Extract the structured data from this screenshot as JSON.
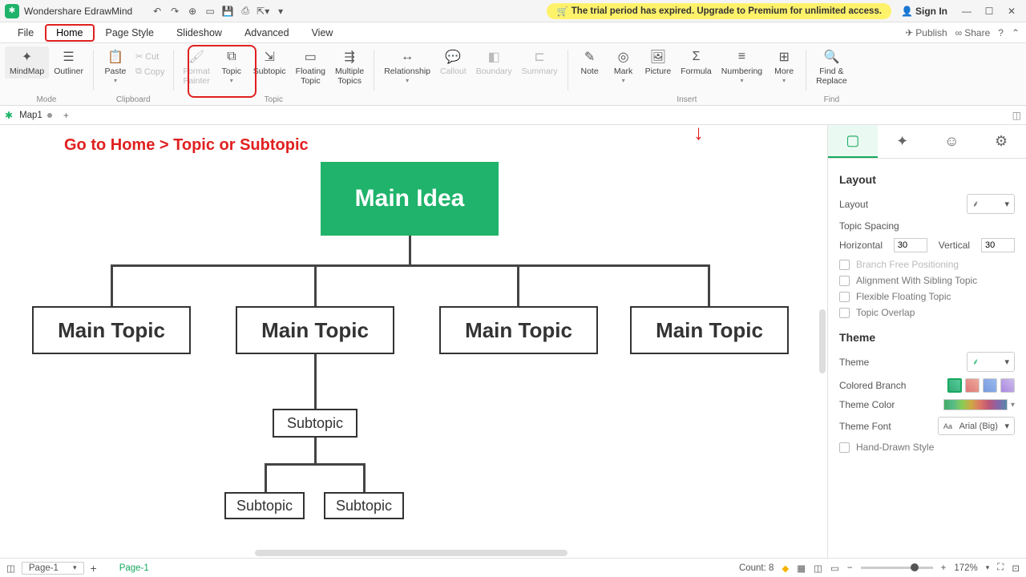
{
  "app": {
    "title": "Wondershare EdrawMind"
  },
  "titlebar": {
    "trial": "The trial period has expired. Upgrade to Premium for unlimited access.",
    "signin": "Sign In"
  },
  "menu": {
    "file": "File",
    "home": "Home",
    "pagestyle": "Page Style",
    "slideshow": "Slideshow",
    "advanced": "Advanced",
    "view": "View",
    "publish": "Publish",
    "share": "Share"
  },
  "ribbon": {
    "mindmap": "MindMap",
    "outliner": "Outliner",
    "mode": "Mode",
    "paste": "Paste",
    "cut": "Cut",
    "copy": "Copy",
    "clipboard": "Clipboard",
    "formatpainter": "Format\nPainter",
    "topic": "Topic",
    "subtopic": "Subtopic",
    "topicGroup": "Topic",
    "floating": "Floating\nTopic",
    "multiple": "Multiple\nTopics",
    "relationship": "Relationship",
    "callout": "Callout",
    "boundary": "Boundary",
    "summary": "Summary",
    "note": "Note",
    "mark": "Mark",
    "picture": "Picture",
    "formula": "Formula",
    "numbering": "Numbering",
    "more": "More",
    "insert": "Insert",
    "findreplace": "Find &\nReplace",
    "find": "Find"
  },
  "tabs": {
    "map1": "Map1"
  },
  "instruction": "Go to Home > Topic or Subtopic",
  "mindmap": {
    "main": "Main Idea",
    "t1": "Main Topic",
    "t2": "Main Topic",
    "t3": "Main Topic",
    "t4": "Main Topic",
    "s1": "Subtopic",
    "s2": "Subtopic",
    "s3": "Subtopic"
  },
  "panel": {
    "layout": "Layout",
    "layoutLabel": "Layout",
    "topicSpacing": "Topic Spacing",
    "horizontal": "Horizontal",
    "hval": "30",
    "vertical": "Vertical",
    "vval": "30",
    "branchFree": "Branch Free Positioning",
    "alignSibling": "Alignment With Sibling Topic",
    "flexFloat": "Flexible Floating Topic",
    "overlap": "Topic Overlap",
    "theme": "Theme",
    "themeLabel": "Theme",
    "coloredBranch": "Colored Branch",
    "themeColor": "Theme Color",
    "themeFont": "Theme Font",
    "fontVal": "Arial (Big)",
    "handDrawn": "Hand-Drawn Style"
  },
  "status": {
    "page": "Page-1",
    "page2": "Page-1",
    "count": "Count: 8",
    "zoom": "172%"
  }
}
